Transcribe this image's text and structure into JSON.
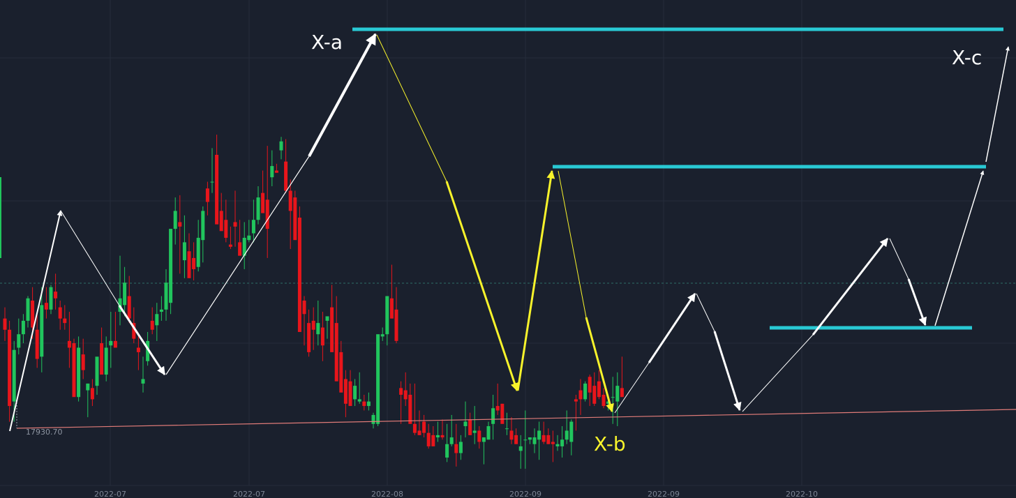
{
  "chart_data": {
    "type": "candlestick",
    "x_tick_labels": [
      "2022-07",
      "2022-07",
      "2022-08",
      "2022-09",
      "2022-09",
      "2022-10"
    ],
    "grid": true,
    "low_marker": {
      "label": "17930.70",
      "value": 17930.7
    },
    "annotations": [
      {
        "label": "X-a",
        "color": "#ffffff"
      },
      {
        "label": "X-b",
        "color": "#f8f32b"
      },
      {
        "label": "X-c",
        "color": "#ffffff"
      }
    ],
    "colors": {
      "up": "#21c55d",
      "down": "#e8151b",
      "level": "#29c9d4",
      "trend": "#e07b78",
      "arrow_white": "#ffffff",
      "arrow_yellow": "#f8f32b"
    },
    "candles": [
      [
        18420,
        18470,
        18320,
        18370
      ],
      [
        18370,
        18410,
        17960,
        18030
      ],
      [
        18050,
        18320,
        17960,
        18280
      ],
      [
        18290,
        18420,
        18260,
        18350
      ],
      [
        18350,
        18440,
        18310,
        18410
      ],
      [
        18410,
        18520,
        18380,
        18510
      ],
      [
        18500,
        18560,
        18330,
        18380
      ],
      [
        18370,
        18450,
        18200,
        18240
      ],
      [
        18250,
        18560,
        18180,
        18480
      ],
      [
        18490,
        18560,
        18420,
        18460
      ],
      [
        18460,
        18570,
        18440,
        18560
      ],
      [
        18540,
        18620,
        18460,
        18510
      ],
      [
        18470,
        18500,
        18370,
        18420
      ],
      [
        18420,
        18480,
        18370,
        18400
      ],
      [
        18320,
        18450,
        18200,
        18290
      ],
      [
        18310,
        18330,
        18120,
        18070
      ],
      [
        18070,
        18340,
        18050,
        18290
      ],
      [
        18260,
        18330,
        18150,
        18190
      ],
      [
        18100,
        18130,
        17980,
        18130
      ],
      [
        18110,
        18150,
        18030,
        18060
      ],
      [
        18120,
        18190,
        18080,
        18250
      ],
      [
        18310,
        18380,
        18220,
        18170
      ],
      [
        18170,
        18340,
        18140,
        18290
      ],
      [
        18300,
        18450,
        18200,
        18320
      ],
      [
        18320,
        18450,
        18290,
        18290
      ],
      [
        18450,
        18700,
        18390,
        18510
      ],
      [
        18480,
        18650,
        18430,
        18580
      ],
      [
        18520,
        18610,
        18400,
        18420
      ],
      [
        18400,
        18470,
        18310,
        18330
      ],
      [
        18290,
        18340,
        18190,
        18270
      ],
      [
        18130,
        18250,
        18090,
        18150
      ],
      [
        18230,
        18360,
        18210,
        18320
      ],
      [
        18410,
        18470,
        18350,
        18370
      ],
      [
        18390,
        18490,
        18320,
        18440
      ],
      [
        18450,
        18520,
        18410,
        18460
      ],
      [
        18460,
        18640,
        18410,
        18580
      ],
      [
        18490,
        18800,
        18440,
        18820
      ],
      [
        18820,
        18960,
        18750,
        18900
      ],
      [
        18850,
        18970,
        18620,
        18830
      ],
      [
        18680,
        18880,
        18600,
        18760
      ],
      [
        18720,
        18800,
        18620,
        18600
      ],
      [
        18690,
        18760,
        18590,
        18640
      ],
      [
        18650,
        18860,
        18630,
        18780
      ],
      [
        18770,
        18920,
        18670,
        18900
      ],
      [
        19000,
        19030,
        18880,
        18940
      ],
      [
        19030,
        19180,
        18980,
        19030
      ],
      [
        19150,
        19240,
        18950,
        18840
      ],
      [
        18900,
        18980,
        18830,
        18810
      ],
      [
        18860,
        18950,
        18760,
        18780
      ],
      [
        18750,
        18830,
        18730,
        18740
      ],
      [
        18850,
        18990,
        18740,
        18830
      ],
      [
        18760,
        18860,
        18730,
        18700
      ],
      [
        18700,
        18850,
        18640,
        18780
      ],
      [
        18770,
        18860,
        18760,
        18790
      ],
      [
        18800,
        18950,
        18760,
        18860
      ],
      [
        18860,
        19010,
        18840,
        18960
      ],
      [
        18980,
        19080,
        18930,
        18890
      ],
      [
        18950,
        19190,
        18690,
        18820
      ],
      [
        19050,
        19170,
        19010,
        19100
      ],
      [
        19080,
        19110,
        19070,
        19070
      ],
      [
        19170,
        19230,
        19130,
        19210
      ],
      [
        19120,
        19220,
        18980,
        18990
      ],
      [
        18990,
        19040,
        18730,
        18900
      ],
      [
        18960,
        18990,
        18880,
        18770
      ],
      [
        18870,
        18920,
        18730,
        18360
      ],
      [
        18500,
        18520,
        18300,
        18440
      ],
      [
        18400,
        18460,
        18250,
        18270
      ],
      [
        18410,
        18470,
        18280,
        18370
      ],
      [
        18350,
        18500,
        18300,
        18400
      ],
      [
        18380,
        18450,
        18230,
        18300
      ],
      [
        18410,
        18430,
        18330,
        18430
      ],
      [
        18470,
        18570,
        18330,
        18270
      ],
      [
        18400,
        18520,
        18280,
        18140
      ],
      [
        18270,
        18320,
        18150,
        18090
      ],
      [
        18150,
        18190,
        17980,
        18040
      ],
      [
        18140,
        18190,
        18100,
        18030
      ],
      [
        18060,
        18150,
        18030,
        18120
      ],
      [
        18050,
        18180,
        18040,
        18060
      ],
      [
        18050,
        18080,
        18010,
        18030
      ],
      [
        18030,
        18090,
        18010,
        18050
      ],
      [
        17950,
        18000,
        17930,
        17990
      ],
      [
        17950,
        18310,
        17940,
        18350
      ],
      [
        18340,
        18380,
        18320,
        18350
      ],
      [
        18350,
        18520,
        18300,
        18520
      ],
      [
        18510,
        18660,
        18440,
        18420
      ],
      [
        18460,
        18560,
        18310,
        18320
      ],
      [
        18110,
        18140,
        17950,
        18080
      ],
      [
        18100,
        18180,
        18030,
        18060
      ],
      [
        18080,
        18130,
        18040,
        17950
      ],
      [
        17950,
        18130,
        17900,
        17910
      ],
      [
        17920,
        18010,
        17900,
        17900
      ],
      [
        17960,
        17990,
        17890,
        17910
      ],
      [
        17910,
        17950,
        17840,
        17850
      ],
      [
        17900,
        17940,
        17850,
        17850
      ],
      [
        17890,
        17960,
        17870,
        17900
      ],
      [
        17900,
        17970,
        17880,
        17890
      ],
      [
        17800,
        17950,
        17780,
        17860
      ],
      [
        17860,
        17990,
        17850,
        17890
      ],
      [
        17860,
        17950,
        17760,
        17820
      ],
      [
        17820,
        17900,
        17790,
        17870
      ],
      [
        17940,
        18050,
        17890,
        17960
      ],
      [
        17970,
        18000,
        17900,
        17900
      ],
      [
        17910,
        18030,
        17860,
        17920
      ],
      [
        17920,
        17940,
        17840,
        17870
      ],
      [
        17870,
        17890,
        17770,
        17890
      ],
      [
        17880,
        17960,
        17880,
        17940
      ],
      [
        17950,
        18080,
        17880,
        18020
      ],
      [
        18030,
        18130,
        17990,
        18010
      ],
      [
        18040,
        18040,
        18000,
        17950
      ],
      [
        17930,
        18000,
        17900,
        17930
      ],
      [
        17920,
        17980,
        17860,
        17880
      ],
      [
        17900,
        17930,
        17860,
        17860
      ],
      [
        17830,
        17900,
        17750,
        17850
      ],
      [
        17880,
        18010,
        17750,
        17880
      ],
      [
        17880,
        17890,
        17860,
        17890
      ],
      [
        17860,
        17930,
        17820,
        17890
      ],
      [
        17880,
        17960,
        17790,
        17920
      ],
      [
        17900,
        17960,
        17860,
        17870
      ],
      [
        17900,
        17930,
        17860,
        17860
      ],
      [
        17870,
        17920,
        17780,
        17860
      ],
      [
        17850,
        17900,
        17830,
        17860
      ],
      [
        17850,
        17940,
        17800,
        17880
      ],
      [
        17880,
        18010,
        17860,
        17920
      ],
      [
        17870,
        17970,
        17810,
        17960
      ],
      [
        18060,
        18080,
        17920,
        18050
      ],
      [
        18100,
        18150,
        17990,
        18060
      ],
      [
        18060,
        18140,
        18050,
        18130
      ],
      [
        18160,
        18170,
        18030,
        18090
      ],
      [
        18120,
        18180,
        18030,
        18040
      ],
      [
        18140,
        18190,
        18060,
        18070
      ],
      [
        18080,
        18110,
        18020,
        18030
      ],
      [
        18040,
        18080,
        18010,
        18050
      ],
      [
        18070,
        18160,
        17950,
        18070
      ],
      [
        18050,
        18180,
        17940,
        18120
      ],
      [
        18110,
        18250,
        18070,
        18070
      ]
    ]
  }
}
